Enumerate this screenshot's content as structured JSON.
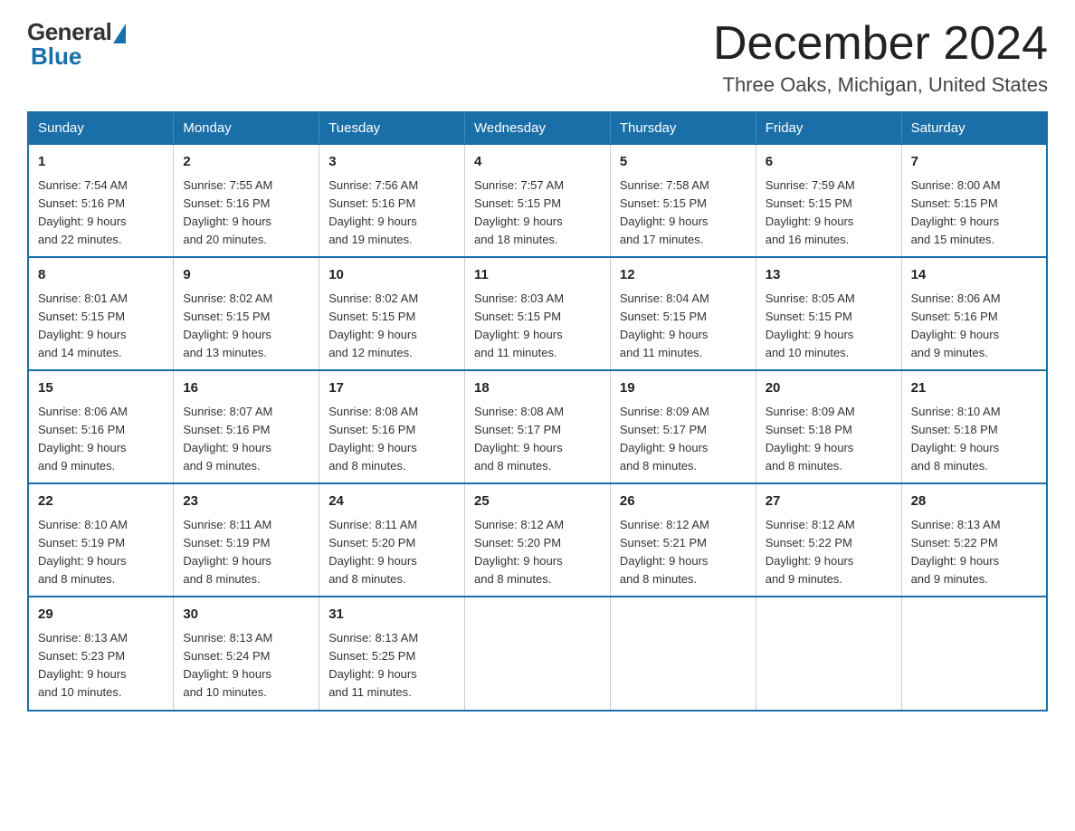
{
  "logo": {
    "general": "General",
    "blue": "Blue"
  },
  "title": "December 2024",
  "location": "Three Oaks, Michigan, United States",
  "days_of_week": [
    "Sunday",
    "Monday",
    "Tuesday",
    "Wednesday",
    "Thursday",
    "Friday",
    "Saturday"
  ],
  "weeks": [
    [
      {
        "day": "1",
        "sunrise": "7:54 AM",
        "sunset": "5:16 PM",
        "daylight": "9 hours and 22 minutes."
      },
      {
        "day": "2",
        "sunrise": "7:55 AM",
        "sunset": "5:16 PM",
        "daylight": "9 hours and 20 minutes."
      },
      {
        "day": "3",
        "sunrise": "7:56 AM",
        "sunset": "5:16 PM",
        "daylight": "9 hours and 19 minutes."
      },
      {
        "day": "4",
        "sunrise": "7:57 AM",
        "sunset": "5:15 PM",
        "daylight": "9 hours and 18 minutes."
      },
      {
        "day": "5",
        "sunrise": "7:58 AM",
        "sunset": "5:15 PM",
        "daylight": "9 hours and 17 minutes."
      },
      {
        "day": "6",
        "sunrise": "7:59 AM",
        "sunset": "5:15 PM",
        "daylight": "9 hours and 16 minutes."
      },
      {
        "day": "7",
        "sunrise": "8:00 AM",
        "sunset": "5:15 PM",
        "daylight": "9 hours and 15 minutes."
      }
    ],
    [
      {
        "day": "8",
        "sunrise": "8:01 AM",
        "sunset": "5:15 PM",
        "daylight": "9 hours and 14 minutes."
      },
      {
        "day": "9",
        "sunrise": "8:02 AM",
        "sunset": "5:15 PM",
        "daylight": "9 hours and 13 minutes."
      },
      {
        "day": "10",
        "sunrise": "8:02 AM",
        "sunset": "5:15 PM",
        "daylight": "9 hours and 12 minutes."
      },
      {
        "day": "11",
        "sunrise": "8:03 AM",
        "sunset": "5:15 PM",
        "daylight": "9 hours and 11 minutes."
      },
      {
        "day": "12",
        "sunrise": "8:04 AM",
        "sunset": "5:15 PM",
        "daylight": "9 hours and 11 minutes."
      },
      {
        "day": "13",
        "sunrise": "8:05 AM",
        "sunset": "5:15 PM",
        "daylight": "9 hours and 10 minutes."
      },
      {
        "day": "14",
        "sunrise": "8:06 AM",
        "sunset": "5:16 PM",
        "daylight": "9 hours and 9 minutes."
      }
    ],
    [
      {
        "day": "15",
        "sunrise": "8:06 AM",
        "sunset": "5:16 PM",
        "daylight": "9 hours and 9 minutes."
      },
      {
        "day": "16",
        "sunrise": "8:07 AM",
        "sunset": "5:16 PM",
        "daylight": "9 hours and 9 minutes."
      },
      {
        "day": "17",
        "sunrise": "8:08 AM",
        "sunset": "5:16 PM",
        "daylight": "9 hours and 8 minutes."
      },
      {
        "day": "18",
        "sunrise": "8:08 AM",
        "sunset": "5:17 PM",
        "daylight": "9 hours and 8 minutes."
      },
      {
        "day": "19",
        "sunrise": "8:09 AM",
        "sunset": "5:17 PM",
        "daylight": "9 hours and 8 minutes."
      },
      {
        "day": "20",
        "sunrise": "8:09 AM",
        "sunset": "5:18 PM",
        "daylight": "9 hours and 8 minutes."
      },
      {
        "day": "21",
        "sunrise": "8:10 AM",
        "sunset": "5:18 PM",
        "daylight": "9 hours and 8 minutes."
      }
    ],
    [
      {
        "day": "22",
        "sunrise": "8:10 AM",
        "sunset": "5:19 PM",
        "daylight": "9 hours and 8 minutes."
      },
      {
        "day": "23",
        "sunrise": "8:11 AM",
        "sunset": "5:19 PM",
        "daylight": "9 hours and 8 minutes."
      },
      {
        "day": "24",
        "sunrise": "8:11 AM",
        "sunset": "5:20 PM",
        "daylight": "9 hours and 8 minutes."
      },
      {
        "day": "25",
        "sunrise": "8:12 AM",
        "sunset": "5:20 PM",
        "daylight": "9 hours and 8 minutes."
      },
      {
        "day": "26",
        "sunrise": "8:12 AM",
        "sunset": "5:21 PM",
        "daylight": "9 hours and 8 minutes."
      },
      {
        "day": "27",
        "sunrise": "8:12 AM",
        "sunset": "5:22 PM",
        "daylight": "9 hours and 9 minutes."
      },
      {
        "day": "28",
        "sunrise": "8:13 AM",
        "sunset": "5:22 PM",
        "daylight": "9 hours and 9 minutes."
      }
    ],
    [
      {
        "day": "29",
        "sunrise": "8:13 AM",
        "sunset": "5:23 PM",
        "daylight": "9 hours and 10 minutes."
      },
      {
        "day": "30",
        "sunrise": "8:13 AM",
        "sunset": "5:24 PM",
        "daylight": "9 hours and 10 minutes."
      },
      {
        "day": "31",
        "sunrise": "8:13 AM",
        "sunset": "5:25 PM",
        "daylight": "9 hours and 11 minutes."
      },
      null,
      null,
      null,
      null
    ]
  ],
  "labels": {
    "sunrise": "Sunrise:",
    "sunset": "Sunset:",
    "daylight": "Daylight:"
  },
  "colors": {
    "header_bg": "#1a6fa8",
    "header_text": "#ffffff",
    "border": "#1a6fa8"
  }
}
